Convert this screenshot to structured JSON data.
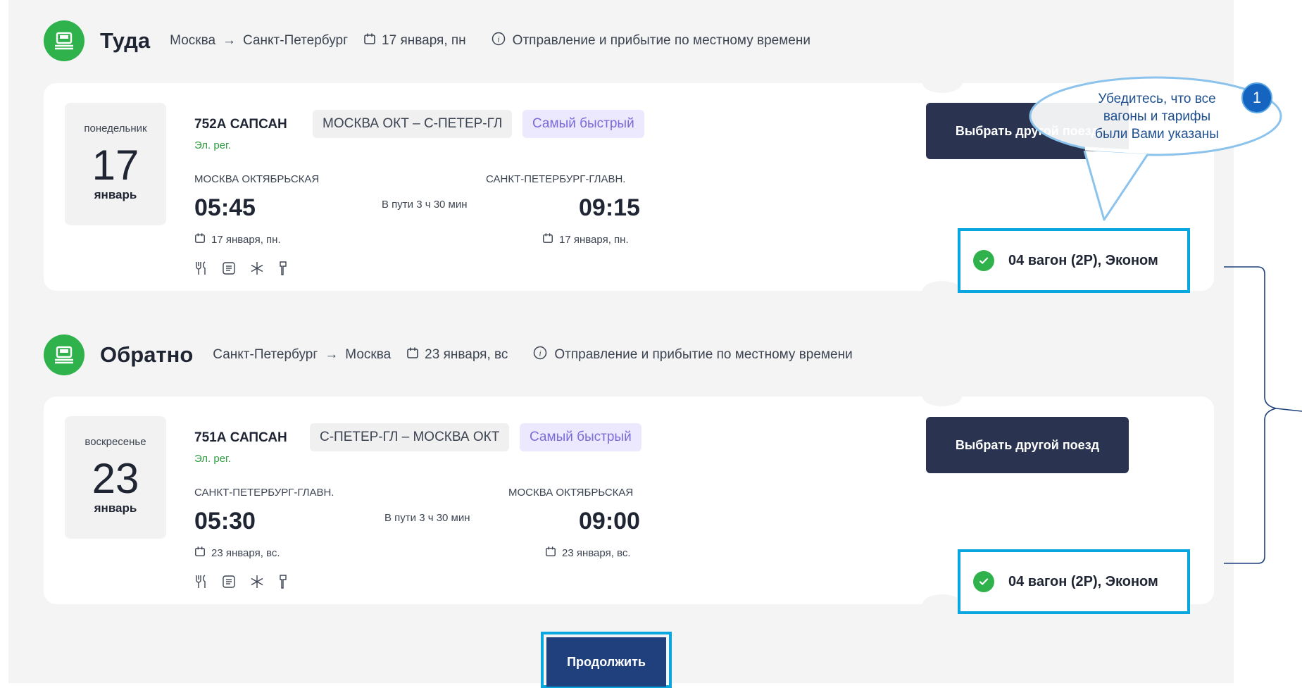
{
  "outbound": {
    "title": "Туда",
    "from": "Москва",
    "arrow": "→",
    "to": "Санкт-Петербург",
    "date": "17 января, пн",
    "note": "Отправление и прибытие по местному времени",
    "train": {
      "day_of_week": "понедельник",
      "day": "17",
      "month": "январь",
      "number": "752А САПСАН",
      "route": "МОСКВА ОКТ – С-ПЕТЕР-ГЛ",
      "badge": "Самый быстрый",
      "reg": "Эл. рег.",
      "dep_station": "МОСКВА ОКТЯБРЬСКАЯ",
      "arr_station": "САНКТ-ПЕТЕРБУРГ-ГЛАВН.",
      "dep_time": "05:45",
      "arr_time": "09:15",
      "duration": "В пути 3 ч 30 мин",
      "dep_date": "17 января, пн.",
      "arr_date": "17 января, пн."
    },
    "button": "Выбрать другой поезд",
    "car": "04 вагон (2Р), Эконом"
  },
  "return": {
    "title": "Обратно",
    "from": "Санкт-Петербург",
    "arrow": "→",
    "to": "Москва",
    "date": "23 января, вс",
    "note": "Отправление и прибытие по местному времени",
    "train": {
      "day_of_week": "воскресенье",
      "day": "23",
      "month": "январь",
      "number": "751А САПСАН",
      "route": "С-ПЕТЕР-ГЛ – МОСКВА ОКТ",
      "badge": "Самый быстрый",
      "reg": "Эл. рег.",
      "dep_station": "САНКТ-ПЕТЕРБУРГ-ГЛАВН.",
      "arr_station": "МОСКВА ОКТЯБРЬСКАЯ",
      "dep_time": "05:30",
      "arr_time": "09:00",
      "duration": "В пути 3 ч 30 мин",
      "dep_date": "23 января, вс.",
      "arr_date": "23 января, вс."
    },
    "button": "Выбрать другой поезд",
    "car": "04 вагон (2Р), Эконом"
  },
  "continue_label": "Продолжить",
  "callout": {
    "number": "1",
    "text_line1": "Убедитесь, что все",
    "text_line2": "вагоны и тарифы",
    "text_line3": "были Вами указаны"
  },
  "icons": {
    "train": "train-icon",
    "calendar": "calendar-icon",
    "info": "info-icon",
    "check": "check-icon",
    "amenities": [
      "restaurant-icon",
      "document-icon",
      "air-conditioning-icon",
      "toilet-icon"
    ]
  },
  "colors": {
    "green": "#2fb24c",
    "dark_button": "#2a3450",
    "continue_button": "#1f3f7d",
    "highlight": "#0aa6df",
    "badge_text": "#7a6bd6",
    "reg_green": "#2e9b3f"
  }
}
